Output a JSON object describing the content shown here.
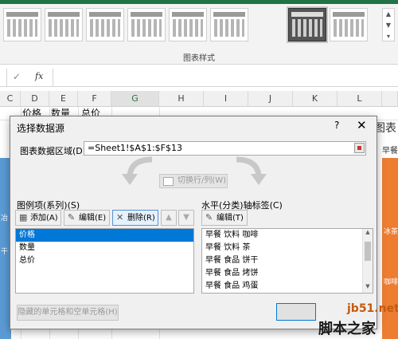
{
  "ribbon": {
    "section_label": "图表样式",
    "style_count": 7
  },
  "formula_bar": {
    "check_icon": "✓",
    "fx_label": "fx",
    "value": ""
  },
  "grid": {
    "columns": [
      "C",
      "D",
      "E",
      "F",
      "G",
      "H",
      "I",
      "J",
      "K",
      "L"
    ],
    "selected_column": "G",
    "row_cells": [
      "价格",
      "数量",
      "总价"
    ]
  },
  "background_chart": {
    "title": "图表",
    "legend": "早餐",
    "orange_label_1": "冰茶",
    "orange_label_2": "咖啡",
    "left_label_1": "冶",
    "left_label_2": "干"
  },
  "dialog": {
    "title": "选择数据源",
    "help": "?",
    "close": "✕",
    "range_label": "图表数据区域(D):",
    "range_value": "=Sheet1!$A$1:$F$13",
    "switch_label": "切换行/列(W)",
    "legend_section": "图例项(系列)(S)",
    "axis_section": "水平(分类)轴标签(C)",
    "add_label": "添加(A)",
    "edit_label": "编辑(E)",
    "remove_label": "删除(R)",
    "up_icon": "▲",
    "down_icon": "▼",
    "axis_edit_label": "编辑(T)",
    "series": [
      "价格",
      "数量",
      "总价"
    ],
    "selected_series_index": 0,
    "axis_labels": [
      "早餐 饮料 咖啡",
      "早餐 饮料 茶",
      "早餐 食品 饼干",
      "早餐 食品 烤饼",
      "早餐 食品 鸡蛋"
    ],
    "hidden_cells_label": "隐藏的单元格和空单元格(H)"
  },
  "watermark": {
    "line1": "jb51.net",
    "line2": "脚本之家"
  },
  "colors": {
    "excel_green": "#217346",
    "selection_blue": "#0078d7",
    "chart_orange": "#ed7d31",
    "chart_blue": "#5b9bd5"
  }
}
